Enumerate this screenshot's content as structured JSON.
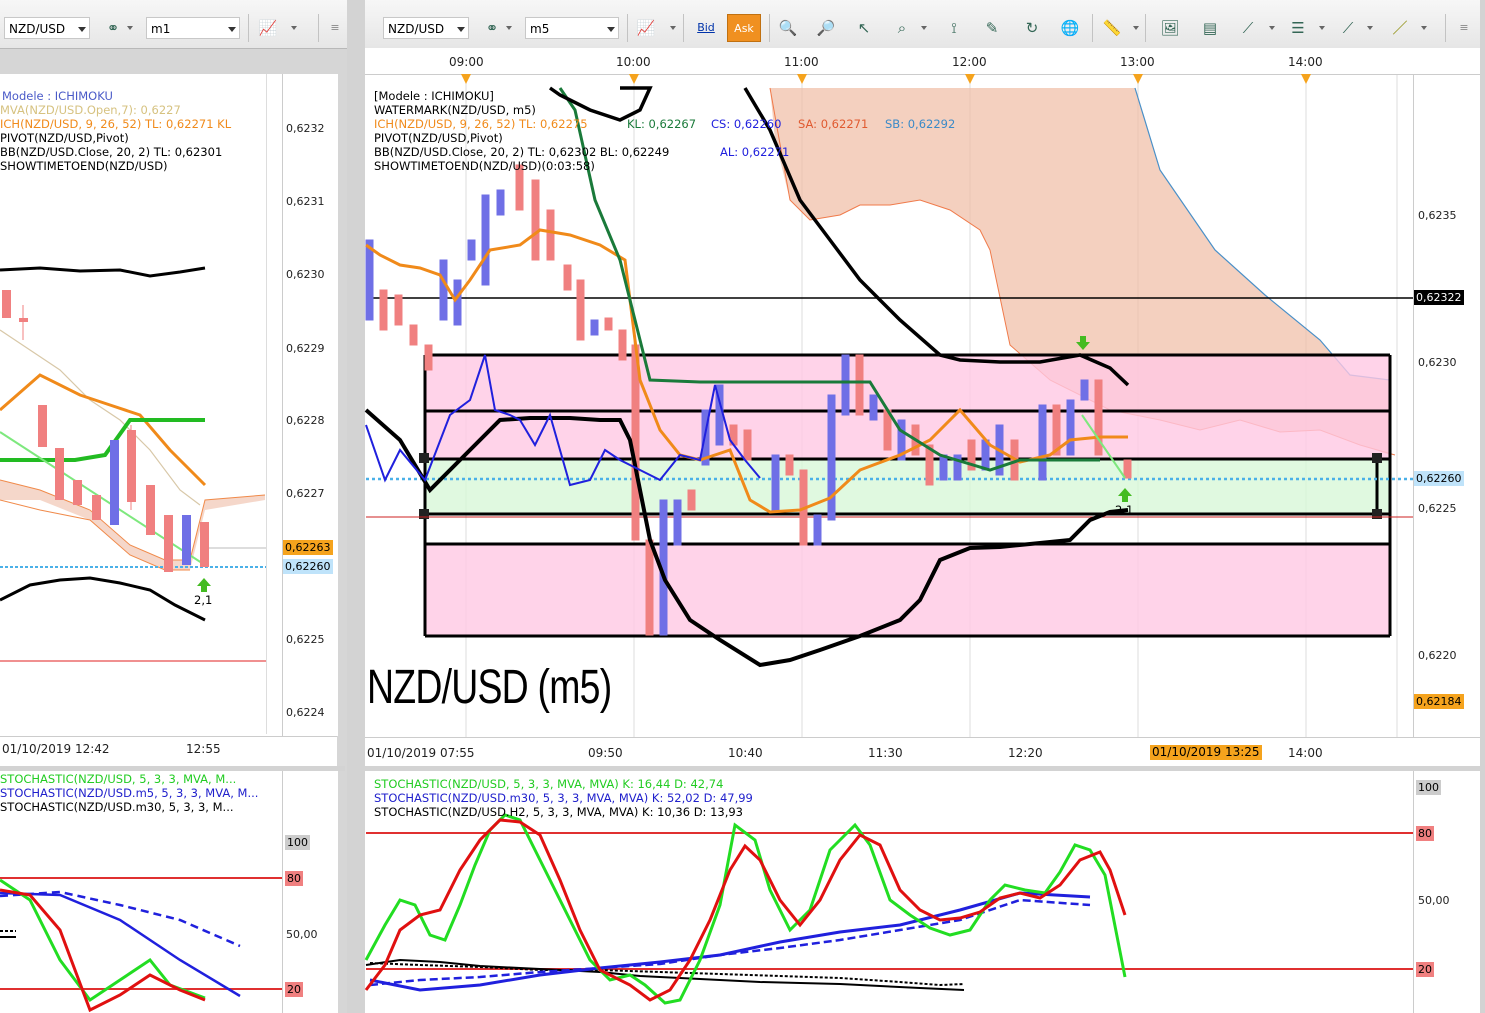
{
  "left_toolbar": {
    "symbol": "NZD/USD",
    "timeframe": "m1"
  },
  "right_toolbar": {
    "symbol": "NZD/USD",
    "timeframe": "m5",
    "bid_label": "Bid",
    "ask_label": "Ask"
  },
  "left_chart": {
    "legend": [
      "Modele : ICHIMOKU",
      "MVA(NZD/USD.Open,7): 0,6227",
      "ICH(NZD/USD, 9, 26, 52)  TL: 0,62271  KL",
      "PIVOT(NZD/USD,Pivot)",
      "BB(NZD/USD.Close, 20, 2)  TL: 0,62301",
      "SHOWTIMETOEND(NZD/USD)"
    ],
    "y_ticks": [
      "0,6232",
      "0,6231",
      "0,6230",
      "0,6229",
      "0,6228",
      "0,6227",
      "0,6225",
      "0,6224"
    ],
    "price_tag_orange": "0,62263",
    "price_tag_blue": "0,62260",
    "x_labels": [
      "01/10/2019 12:42",
      "12:55"
    ],
    "annotation": "2,1",
    "colors": {
      "orange": "#f08a1a",
      "green": "#22bb22",
      "red_candle": "#f08080",
      "blue_candle": "#6f6fe6",
      "cloud": "#f4d3c4",
      "dot_line": "#4ab0e8"
    }
  },
  "left_stoch": {
    "legend": [
      "STOCHASTIC(NZD/USD, 5, 3, 3, MVA, M...",
      "STOCHASTIC(NZD/USD.m5, 5, 3, 3, MVA, M...",
      "STOCHASTIC(NZD/USD.m30, 5, 3, 3, M..."
    ],
    "y_ticks": [
      "100",
      "80",
      "50,00",
      "20"
    ]
  },
  "main_chart": {
    "top_times": [
      "09:00",
      "10:00",
      "11:00",
      "12:00",
      "13:00",
      "14:00"
    ],
    "legend": {
      "l1": "[Modele : ICHIMOKU]",
      "l2": "WATERMARK(NZD/USD, m5)",
      "l3a": "ICH(NZD/USD, 9, 26, 52)  TL: 0,62275",
      "l3b": "KL: 0,62267",
      "l3c": "CS: 0,62260",
      "l3d": "SA: 0,62271",
      "l3e": "SB: 0,62292",
      "l4": "PIVOT(NZD/USD,Pivot)",
      "l5a": "BB(NZD/USD.Close, 20, 2)  TL: 0,62302  BL: 0,62249",
      "l5b": "AL: 0,62271",
      "l6": "SHOWTIMETOEND(NZD/USD)(0:03:58)"
    },
    "watermark": "NZD/USD (m5)",
    "y_ticks": [
      "0,6235",
      "0,6230",
      "0,6225",
      "0,6220"
    ],
    "price_tags": {
      "black": "0,62322",
      "blue": "0,62260",
      "orange": "0,62184"
    },
    "x_labels": [
      "01/10/2019 07:55",
      "09:50",
      "10:40",
      "11:30",
      "12:20",
      "14:00"
    ],
    "time_tag": "01/10/2019 13:25",
    "annotation": "2,1"
  },
  "main_stoch": {
    "legend": [
      "STOCHASTIC(NZD/USD, 5, 3, 3, MVA, MVA)  K: 16,44  D: 42,74",
      "STOCHASTIC(NZD/USD.m30, 5, 3, 3, MVA, MVA)  K: 52,02  D: 47,99",
      "STOCHASTIC(NZD/USD.H2, 5, 3, 3, MVA, MVA)  K: 10,36  D: 13,93"
    ],
    "y_ticks": [
      "100",
      "80",
      "50,00",
      "20"
    ]
  }
}
